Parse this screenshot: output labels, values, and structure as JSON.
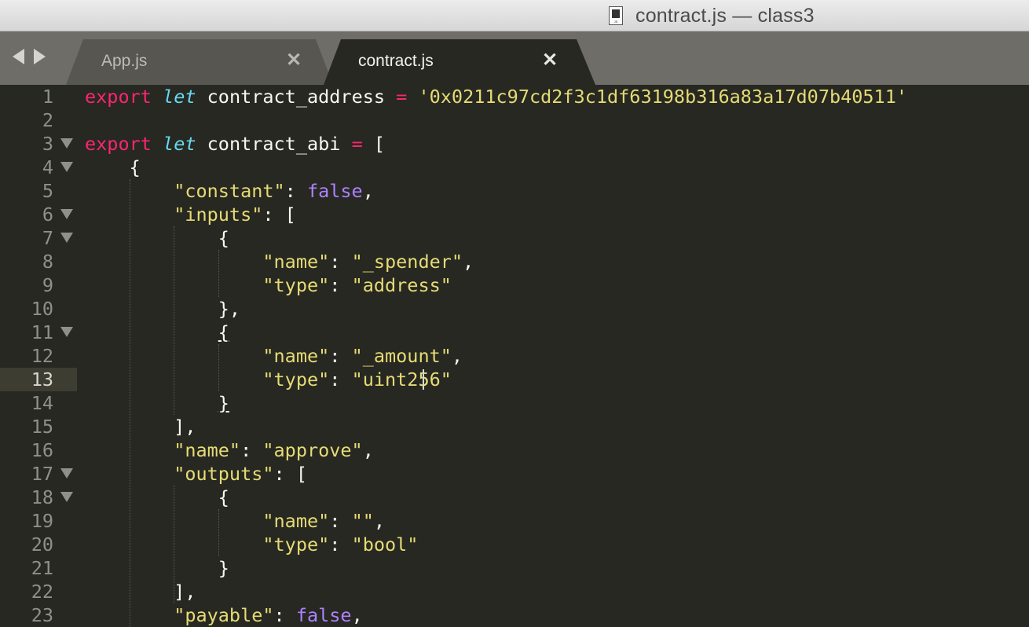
{
  "window": {
    "title": "contract.js — class3",
    "file_icon_tag": "JS"
  },
  "tabs": [
    {
      "label": "App.js",
      "close": "✕",
      "active": false
    },
    {
      "label": "contract.js",
      "close": "✕",
      "active": true
    }
  ],
  "editor": {
    "active_line": "13",
    "lines": [
      {
        "n": "1",
        "fold": false,
        "tokens": [
          [
            "kw",
            "export"
          ],
          [
            "p",
            " "
          ],
          [
            "st",
            "let"
          ],
          [
            "p",
            " contract_address "
          ],
          [
            "kw",
            "="
          ],
          [
            "p",
            " "
          ],
          [
            "str",
            "'0x0211c97cd2f3c1df63198b316a83a17d07b40511'"
          ]
        ]
      },
      {
        "n": "2",
        "fold": false,
        "tokens": []
      },
      {
        "n": "3",
        "fold": true,
        "tokens": [
          [
            "kw",
            "export"
          ],
          [
            "p",
            " "
          ],
          [
            "st",
            "let"
          ],
          [
            "p",
            " contract_abi "
          ],
          [
            "kw",
            "="
          ],
          [
            "p",
            " ["
          ]
        ]
      },
      {
        "n": "4",
        "fold": true,
        "tokens": [
          [
            "p",
            "    {"
          ]
        ]
      },
      {
        "n": "5",
        "fold": false,
        "tokens": [
          [
            "p",
            "        "
          ],
          [
            "str",
            "\"constant\""
          ],
          [
            "p",
            ": "
          ],
          [
            "num",
            "false"
          ],
          [
            "p",
            ","
          ]
        ]
      },
      {
        "n": "6",
        "fold": true,
        "tokens": [
          [
            "p",
            "        "
          ],
          [
            "str",
            "\"inputs\""
          ],
          [
            "p",
            ": ["
          ]
        ]
      },
      {
        "n": "7",
        "fold": true,
        "tokens": [
          [
            "p",
            "            {"
          ]
        ]
      },
      {
        "n": "8",
        "fold": false,
        "tokens": [
          [
            "p",
            "                "
          ],
          [
            "str",
            "\"name\""
          ],
          [
            "p",
            ": "
          ],
          [
            "str",
            "\"_spender\""
          ],
          [
            "p",
            ","
          ]
        ]
      },
      {
        "n": "9",
        "fold": false,
        "tokens": [
          [
            "p",
            "                "
          ],
          [
            "str",
            "\"type\""
          ],
          [
            "p",
            ": "
          ],
          [
            "str",
            "\"address\""
          ]
        ]
      },
      {
        "n": "10",
        "fold": false,
        "tokens": [
          [
            "p",
            "            },"
          ]
        ]
      },
      {
        "n": "11",
        "fold": true,
        "tokens": [
          [
            "p",
            "            "
          ],
          [
            "u",
            "{"
          ]
        ]
      },
      {
        "n": "12",
        "fold": false,
        "tokens": [
          [
            "p",
            "                "
          ],
          [
            "str",
            "\"name\""
          ],
          [
            "p",
            ": "
          ],
          [
            "str",
            "\"_amount\""
          ],
          [
            "p",
            ","
          ]
        ]
      },
      {
        "n": "13",
        "fold": false,
        "tokens": [
          [
            "p",
            "                "
          ],
          [
            "str",
            "\"type\""
          ],
          [
            "p",
            ": "
          ],
          [
            "str",
            "\"uint256\""
          ]
        ]
      },
      {
        "n": "14",
        "fold": false,
        "tokens": [
          [
            "p",
            "            "
          ],
          [
            "u",
            "}"
          ]
        ]
      },
      {
        "n": "15",
        "fold": false,
        "tokens": [
          [
            "p",
            "        ],"
          ]
        ]
      },
      {
        "n": "16",
        "fold": false,
        "tokens": [
          [
            "p",
            "        "
          ],
          [
            "str",
            "\"name\""
          ],
          [
            "p",
            ": "
          ],
          [
            "str",
            "\"approve\""
          ],
          [
            "p",
            ","
          ]
        ]
      },
      {
        "n": "17",
        "fold": true,
        "tokens": [
          [
            "p",
            "        "
          ],
          [
            "str",
            "\"outputs\""
          ],
          [
            "p",
            ": ["
          ]
        ]
      },
      {
        "n": "18",
        "fold": true,
        "tokens": [
          [
            "p",
            "            {"
          ]
        ]
      },
      {
        "n": "19",
        "fold": false,
        "tokens": [
          [
            "p",
            "                "
          ],
          [
            "str",
            "\"name\""
          ],
          [
            "p",
            ": "
          ],
          [
            "str",
            "\"\""
          ],
          [
            "p",
            ","
          ]
        ]
      },
      {
        "n": "20",
        "fold": false,
        "tokens": [
          [
            "p",
            "                "
          ],
          [
            "str",
            "\"type\""
          ],
          [
            "p",
            ": "
          ],
          [
            "str",
            "\"bool\""
          ]
        ]
      },
      {
        "n": "21",
        "fold": false,
        "tokens": [
          [
            "p",
            "            }"
          ]
        ]
      },
      {
        "n": "22",
        "fold": false,
        "tokens": [
          [
            "p",
            "        ],"
          ]
        ]
      },
      {
        "n": "23",
        "fold": false,
        "tokens": [
          [
            "p",
            "        "
          ],
          [
            "str",
            "\"payable\""
          ],
          [
            "p",
            ": "
          ],
          [
            "num",
            "false"
          ],
          [
            "p",
            ","
          ]
        ]
      }
    ]
  },
  "colors": {
    "background": "#272822",
    "keyword": "#f92672",
    "storage": "#66d9ef",
    "string": "#e6db74",
    "constant": "#ae81ff",
    "line_number": "#8f908a",
    "tab_bar": "#6e6d67"
  }
}
